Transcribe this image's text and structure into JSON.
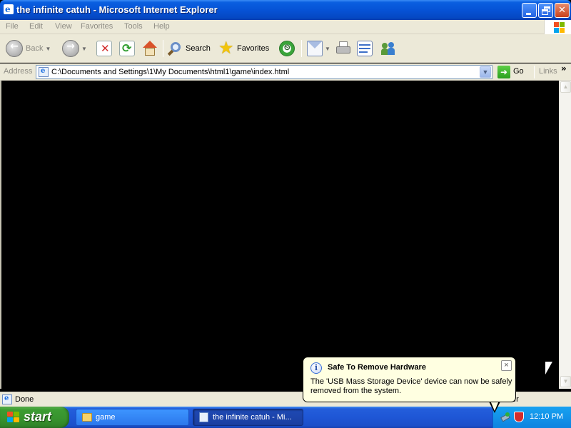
{
  "window": {
    "title": "the infinite catuh - Microsoft Internet Explorer"
  },
  "menu": {
    "items": [
      "File",
      "Edit",
      "View",
      "Favorites",
      "Tools",
      "Help"
    ]
  },
  "toolbar": {
    "back_label": "Back",
    "search_label": "Search",
    "favorites_label": "Favorites"
  },
  "address": {
    "label": "Address",
    "url": "C:\\Documents and Settings\\1\\My Documents\\html1\\game\\index.html",
    "go_label": "Go",
    "links_label": "Links",
    "more_glyph": "»"
  },
  "status": {
    "text": "Done",
    "zone_fragment": "ter"
  },
  "taskbar": {
    "start_label": "start",
    "tasks": [
      {
        "label": "game"
      },
      {
        "label": "the infinite catuh - Mi..."
      }
    ],
    "clock": "12:10 PM"
  },
  "balloon": {
    "title": "Safe To Remove Hardware",
    "body": "The 'USB Mass Storage Device' device can now be safely removed from the system.",
    "close_glyph": "×"
  },
  "colors": {
    "titlebar": "#0653d6",
    "chrome": "#ece9d8",
    "content": "#000000",
    "taskbar": "#245edb",
    "start_button": "#3c9c32",
    "balloon": "#ffffe1"
  }
}
